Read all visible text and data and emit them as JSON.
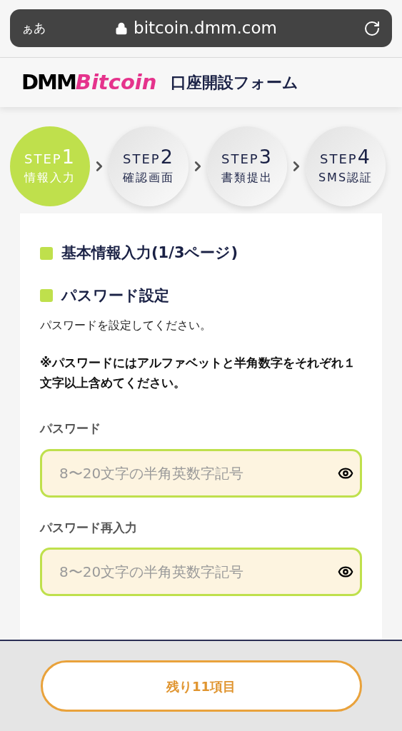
{
  "browser": {
    "text_size": "ぁあ",
    "url": "bitcoin.dmm.com"
  },
  "header": {
    "logo_brand": "DMM",
    "logo_name": "Bitcoin",
    "title": "口座開設フォーム"
  },
  "steps": [
    {
      "label": "STEP",
      "number": "1",
      "name": "情報入力",
      "selected": true
    },
    {
      "label": "STEP",
      "number": "2",
      "name": "確認画面",
      "selected": false
    },
    {
      "label": "STEP",
      "number": "3",
      "name": "書類提出",
      "selected": false
    },
    {
      "label": "STEP",
      "number": "4",
      "name": "SMS認証",
      "selected": false
    }
  ],
  "headings": [
    "基本情報入力(1/3ページ)",
    "パスワード設定"
  ],
  "description": "パスワードを設定してください。",
  "note": "※パスワードにはアルファベットと半角数字をそれぞれ１文字以上含めてください。",
  "fields": [
    {
      "label": "パスワード",
      "placeholder": "8〜20文字の半角英数字記号"
    },
    {
      "label": "パスワード再入力",
      "placeholder": "8〜20文字の半角英数字記号"
    }
  ],
  "remaining_button": "残り11項目"
}
